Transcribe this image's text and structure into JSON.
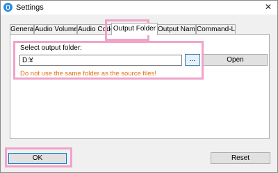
{
  "window": {
    "title": "Settings",
    "close_glyph": "✕",
    "icon": "settings-app-icon"
  },
  "tabs": [
    {
      "label": "General"
    },
    {
      "label": "Audio Volume"
    },
    {
      "label": "Audio Codec"
    },
    {
      "label": "Output Folder",
      "selected": true
    },
    {
      "label": "Output Name"
    },
    {
      "label": "Command-Line"
    }
  ],
  "output_folder": {
    "label": "Select output folder:",
    "path_value": "D:¥",
    "browse_label": "...",
    "open_label": "Open",
    "warning": "Do not use the same folder as the source files!",
    "warning_color": "#e07010"
  },
  "footer": {
    "ok_label": "OK",
    "reset_label": "Reset"
  },
  "highlight_color": "#f0a3c8"
}
